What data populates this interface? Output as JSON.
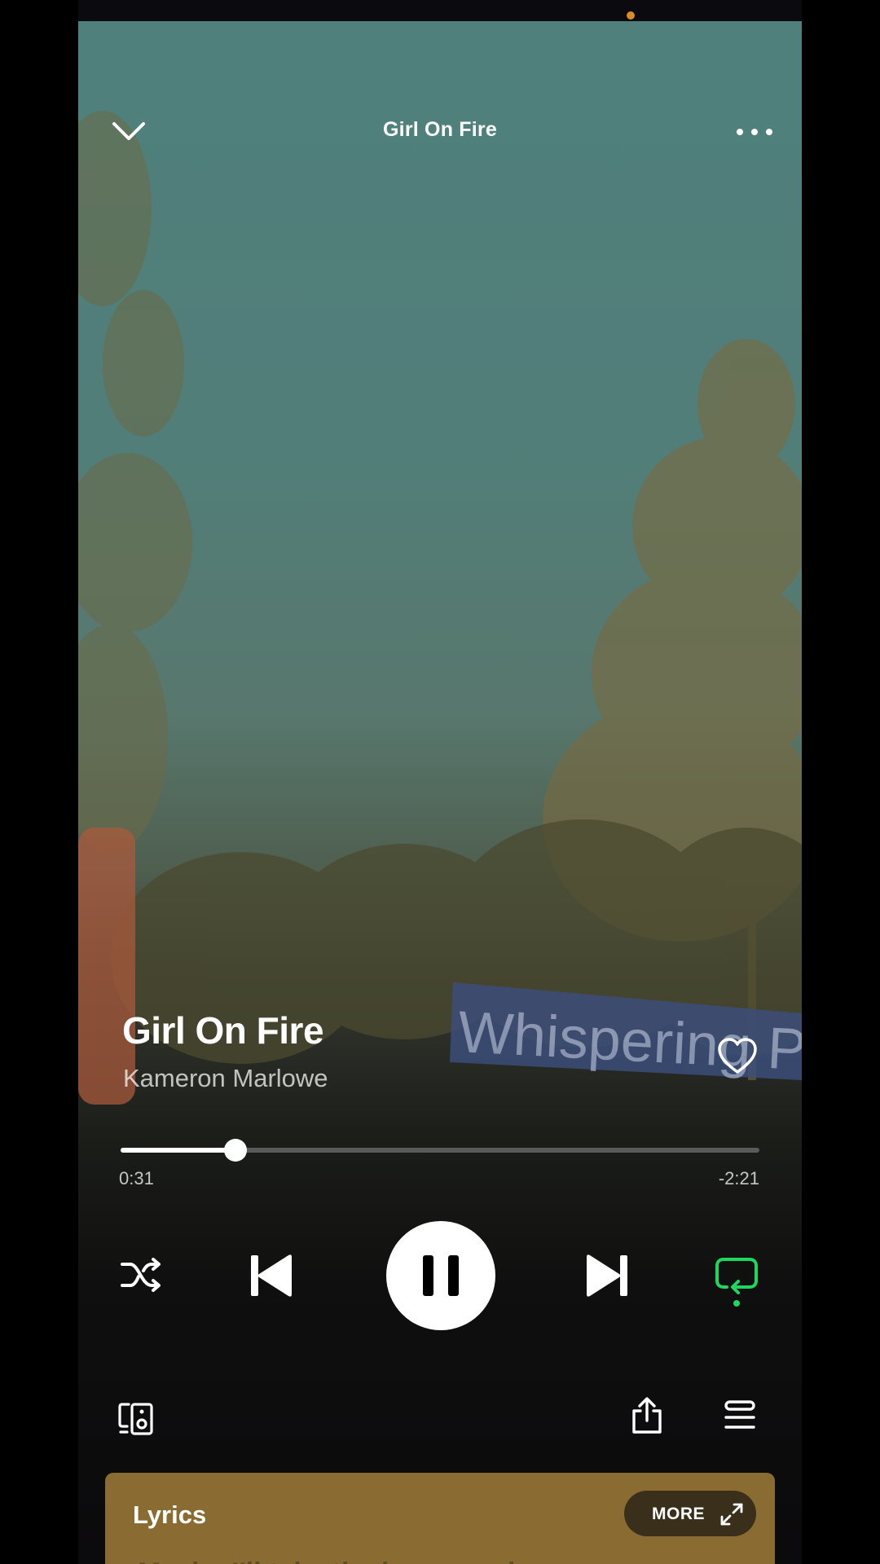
{
  "header": {
    "title": "Girl On Fire",
    "back_icon": "chevron-down-icon",
    "menu_icon": "more-horizontal-icon"
  },
  "track": {
    "title": "Girl On Fire",
    "artist": "Kameron Marlowe",
    "liked": false
  },
  "playback": {
    "elapsed": "0:31",
    "remaining": "-2:21",
    "progress_fraction": 0.18,
    "state": "playing",
    "shuffle": false,
    "repeat": true
  },
  "artwork": {
    "sign_text": "Whispering Pine"
  },
  "bottom_bar": {
    "devices_icon": "devices-icon",
    "share_icon": "share-icon",
    "queue_icon": "queue-icon"
  },
  "lyrics": {
    "label": "Lyrics",
    "more_label": "MORE",
    "peek_line": "Maybe I'll take the long way home"
  },
  "colors": {
    "accent_green": "#1ed760",
    "lyrics_card": "#8a6c33",
    "camera_dot": "#d98c24"
  }
}
